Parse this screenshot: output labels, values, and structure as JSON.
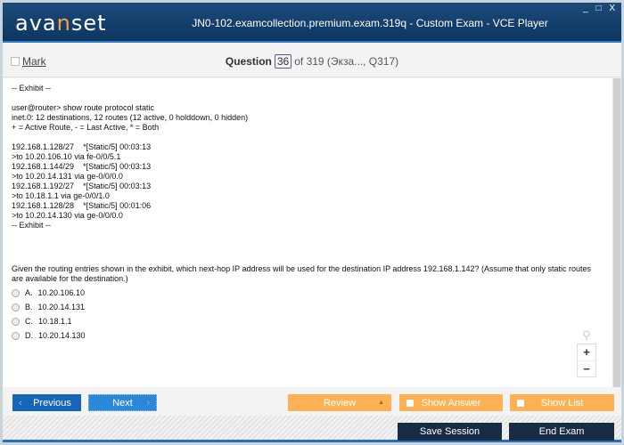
{
  "window": {
    "logo": "avanset",
    "title": "JN0-102.examcollection.premium.exam.319q - Custom Exam - VCE Player",
    "controls": "_ □ X"
  },
  "toolbar": {
    "mark_label": "Mark",
    "question_label": "Question",
    "current": "36",
    "of_text": "of 319 (Экза..., Q317)"
  },
  "exhibit": [
    "-- Exhibit --",
    "",
    "user@router> show route protocol static",
    "inet.0: 12 destinations, 12 routes (12 active, 0 holddown, 0 hidden)",
    "+ = Active Route, - = Last Active, * = Both",
    "",
    "192.168.1.128/27    *[Static/5] 00:03:13",
    ">to 10.20.106.10 via fe-0/0/5.1",
    "192.168.1.144/29    *[Static/5] 00:03:13",
    ">to 10.20.14.131 via ge-0/0/0.0",
    "192.168.1.192/27    *[Static/5] 00:03:13",
    ">to 10.18.1.1 via ge-0/0/1.0",
    "192.168.1.128/28    *[Static/5] 00:01:06",
    ">to 10.20.14.130 via ge-0/0/0.0",
    "-- Exhibit --"
  ],
  "question": "Given the routing entries shown in the exhibit, which next-hop IP address will be used for the destination IP address 192.168.1.142? (Assume that only static routes are available for the destination.)",
  "options": [
    {
      "letter": "A.",
      "text": "10.20.106.10"
    },
    {
      "letter": "B.",
      "text": "10.20.14.131"
    },
    {
      "letter": "C.",
      "text": "10.18.1.1"
    },
    {
      "letter": "D.",
      "text": "10.20.14.130"
    }
  ],
  "zoom": {
    "icon": "magnifier-icon",
    "plus": "+",
    "minus": "−"
  },
  "buttons": {
    "previous": "Previous",
    "next": "Next",
    "review": "Review",
    "show_answer": "Show Answer",
    "show_list": "Show List",
    "save_session": "Save Session",
    "end_exam": "End Exam"
  },
  "colors": {
    "titlebar": "#0d3660",
    "orange": "#fdb154",
    "blue_button": "#1565b8",
    "dark_button": "#182d45"
  }
}
